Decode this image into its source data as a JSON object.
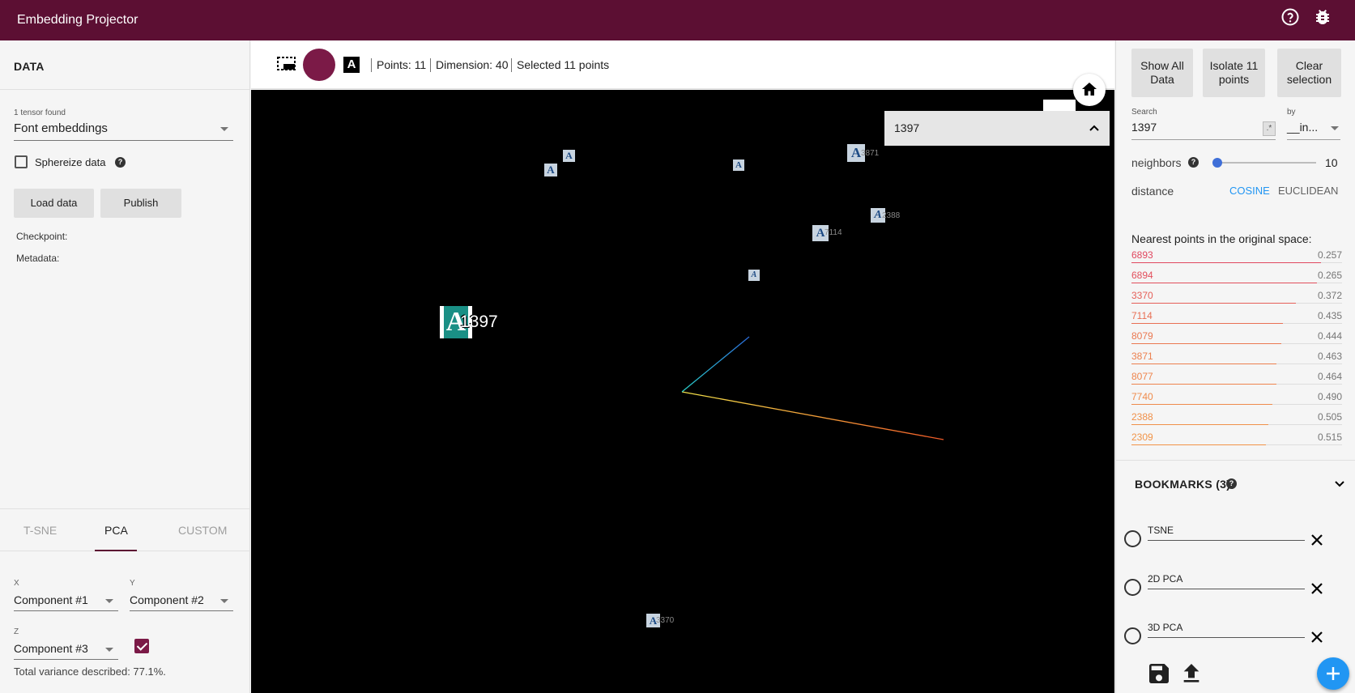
{
  "app": {
    "title": "Embedding Projector"
  },
  "header_icons": [
    "help-icon",
    "bug-icon"
  ],
  "left": {
    "section_title": "DATA",
    "tensor_found": "1 tensor found",
    "tensor_selected": "Font embeddings",
    "sphereize_label": "Sphereize data",
    "load_button": "Load data",
    "publish_button": "Publish",
    "checkpoint_label": "Checkpoint:",
    "metadata_label": "Metadata:",
    "tabs": [
      "T-SNE",
      "PCA",
      "CUSTOM"
    ],
    "active_tab": "PCA",
    "x_label": "X",
    "x_value": "Component #1",
    "y_label": "Y",
    "y_value": "Component #2",
    "z_label": "Z",
    "z_value": "Component #3",
    "z_checked": true,
    "variance_text": "Total variance described: 77.1%."
  },
  "toolbar": {
    "points": "Points: 11",
    "dimension": "Dimension: 40",
    "selected": "Selected 11 points",
    "icons": [
      "selection-box-icon",
      "night-mode-icon",
      "label-toggle-icon"
    ]
  },
  "canvas": {
    "search_popup_text": "1397",
    "main_label": "1397",
    "point_labels": [
      "3871",
      "2388",
      "7114",
      "3370"
    ],
    "sprite_glyph": "A"
  },
  "right": {
    "show_all": "Show All Data",
    "isolate": "Isolate 11 points",
    "clear": "Clear selection",
    "search_label": "Search",
    "search_value": "1397",
    "regex_badge": ".*",
    "by_label": "by",
    "by_value": "__in...",
    "neighbors_label": "neighbors",
    "neighbors_value": "10",
    "distance_label": "distance",
    "distance_cosine": "COSINE",
    "distance_euclidean": "EUCLIDEAN",
    "nn_title": "Nearest points in the original space:",
    "neighbors": [
      {
        "id": "6893",
        "value": "0.257",
        "color": "#e0475f",
        "ratio": 0.9
      },
      {
        "id": "6894",
        "value": "0.265",
        "color": "#e24f5c",
        "ratio": 0.88
      },
      {
        "id": "3370",
        "value": "0.372",
        "color": "#e55f58",
        "ratio": 0.78
      },
      {
        "id": "7114",
        "value": "0.435",
        "color": "#e86f54",
        "ratio": 0.72
      },
      {
        "id": "8079",
        "value": "0.444",
        "color": "#ea7851",
        "ratio": 0.71
      },
      {
        "id": "3871",
        "value": "0.463",
        "color": "#ec804f",
        "ratio": 0.69
      },
      {
        "id": "8077",
        "value": "0.464",
        "color": "#ee854d",
        "ratio": 0.69
      },
      {
        "id": "7740",
        "value": "0.490",
        "color": "#ef8b4b",
        "ratio": 0.67
      },
      {
        "id": "2388",
        "value": "0.505",
        "color": "#f09049",
        "ratio": 0.65
      },
      {
        "id": "2309",
        "value": "0.515",
        "color": "#f19448",
        "ratio": 0.64
      }
    ],
    "bookmarks_title": "BOOKMARKS (3)",
    "bookmarks": [
      "TSNE",
      "2D PCA",
      "3D PCA"
    ]
  }
}
